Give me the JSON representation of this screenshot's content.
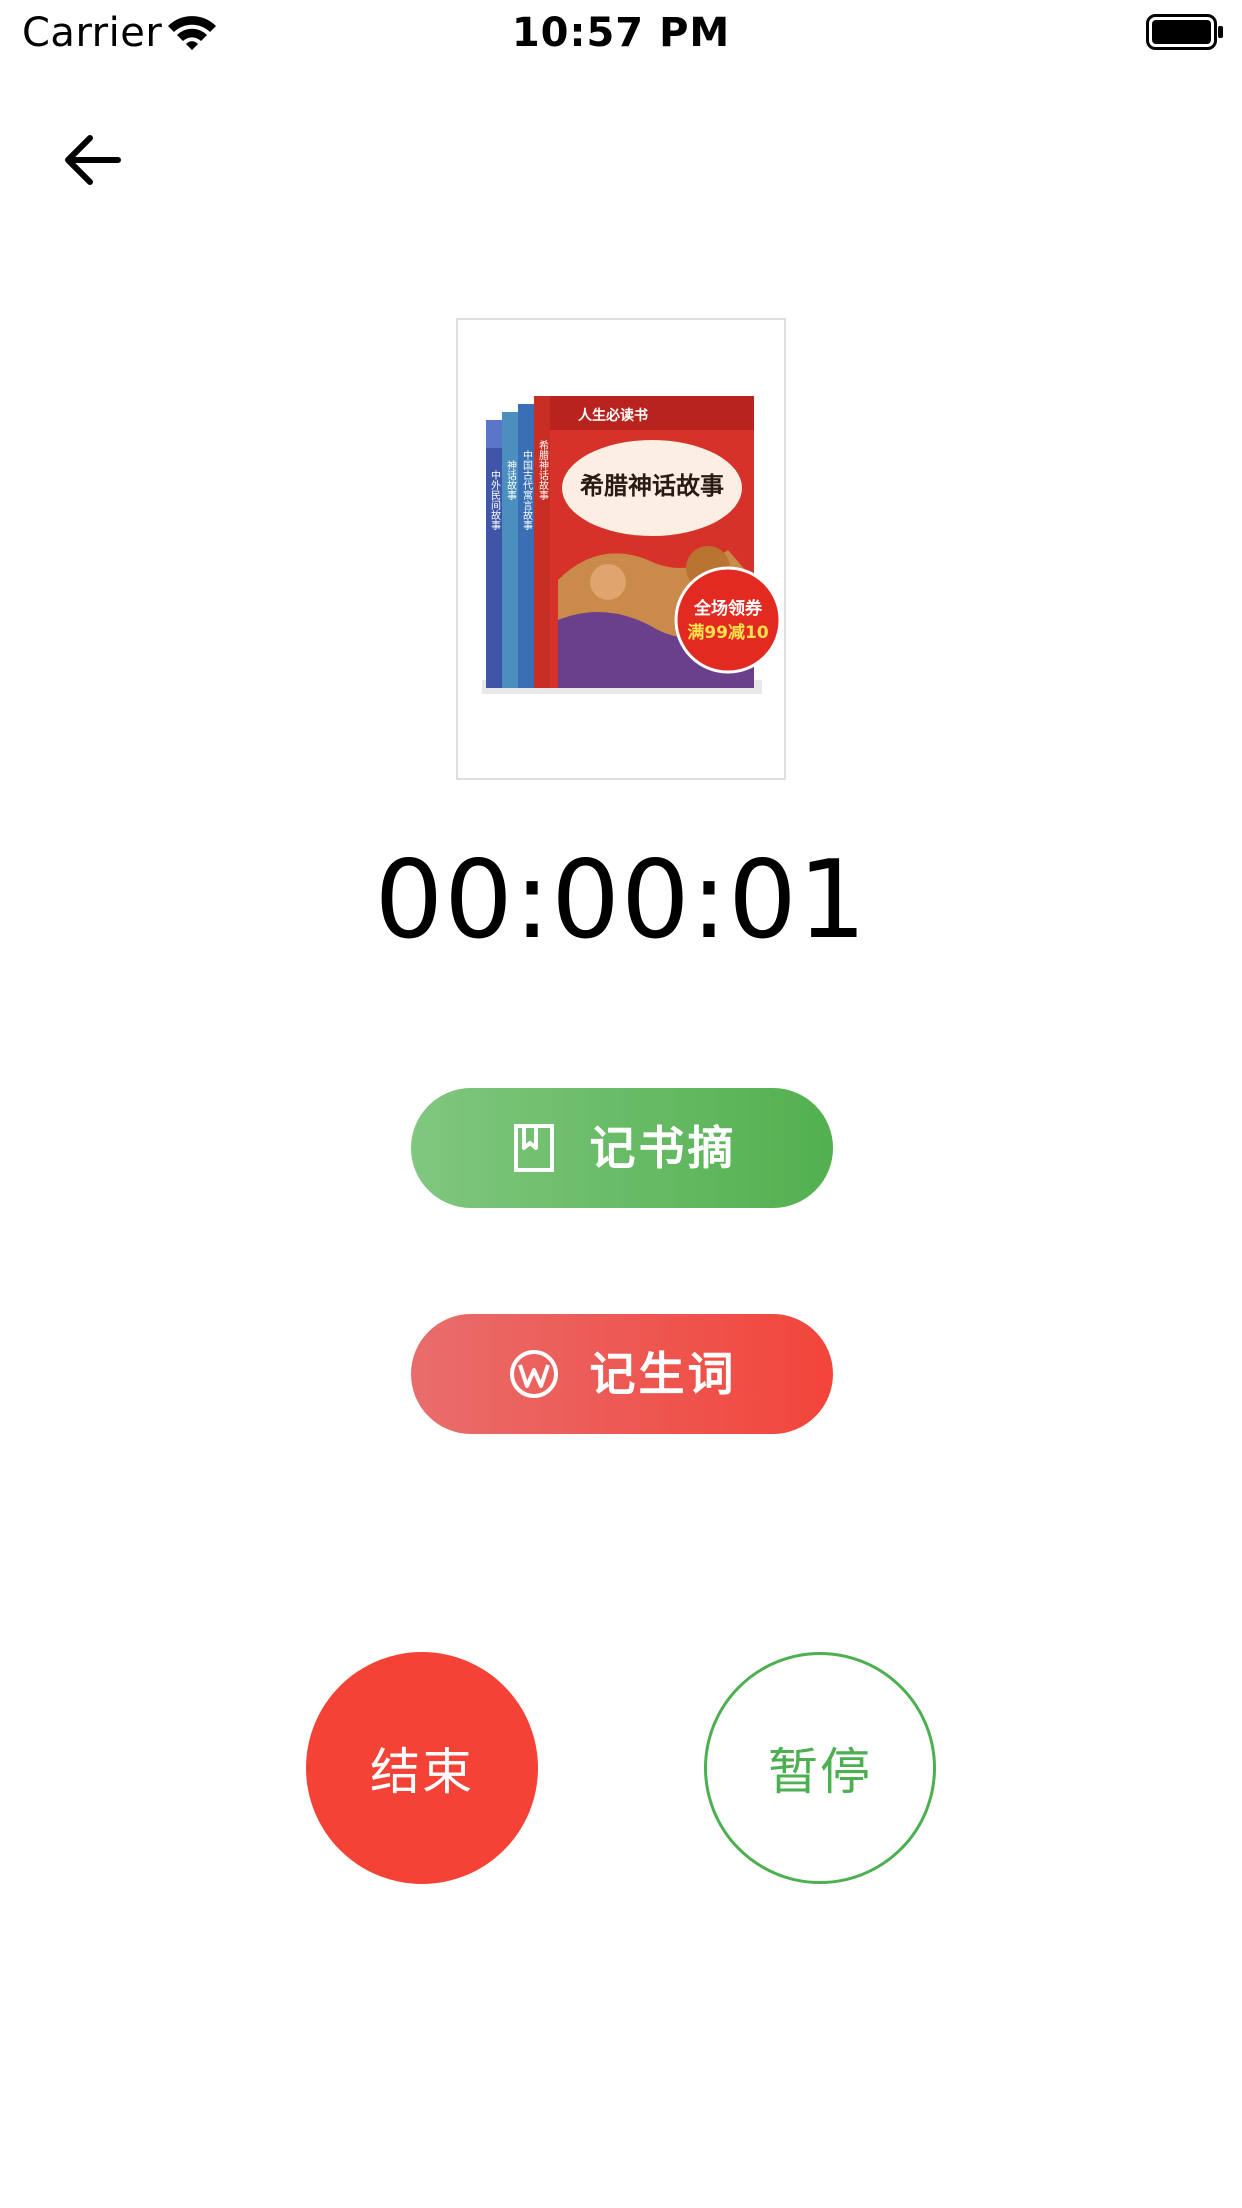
{
  "status_bar": {
    "carrier": "Carrier",
    "time": "10:57 PM"
  },
  "nav": {
    "back_icon": "arrow-left-icon"
  },
  "book": {
    "cover_main_title": "希腊神话故事",
    "cover_spine_titles": [
      "中外民间故事",
      "神话故事",
      "中国古代寓言故事",
      "希腊神话故事"
    ],
    "cover_series_label": "人生必读书",
    "badge_line1": "全场领券",
    "badge_line2": "满99减10"
  },
  "timer": {
    "value": "00:00:01"
  },
  "actions": {
    "excerpt_label": "记书摘",
    "excerpt_icon": "bookmark-book-icon",
    "vocab_label": "记生词",
    "vocab_icon": "wordpress-w-icon"
  },
  "controls": {
    "end_label": "结束",
    "pause_label": "暂停"
  },
  "colors": {
    "green": "#4caf50",
    "red": "#f44336"
  }
}
